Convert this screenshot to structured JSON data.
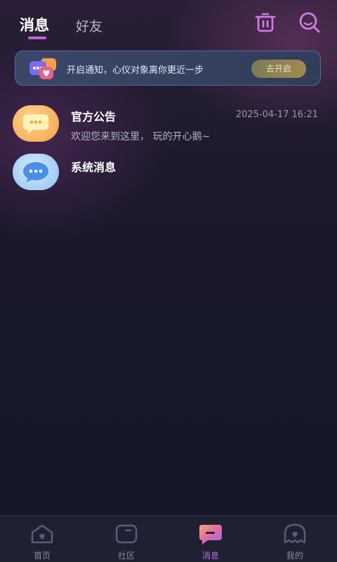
{
  "header": {
    "tabs": [
      {
        "label": "消息",
        "active": true
      },
      {
        "label": "好友",
        "active": false
      }
    ],
    "icons": [
      "trash-icon",
      "search-icon"
    ]
  },
  "banner": {
    "text": "开启通知，心仪对象离你更近一步",
    "button_label": "去开启"
  },
  "messages": [
    {
      "title": "官方公告",
      "time": "2025-04-17 16:21",
      "preview": "欢迎您来到这里， 玩的开心鹅~",
      "icon": "chat-bubble-icon",
      "avatar_color": "#f7b560"
    },
    {
      "title": "系统消息",
      "time": "",
      "preview": "",
      "icon": "chat-bubble-icon",
      "avatar_color": "#8ec3f2"
    }
  ],
  "bottom_nav": [
    {
      "label": "首页",
      "icon": "home-icon",
      "active": false
    },
    {
      "label": "社区",
      "icon": "community-icon",
      "active": false
    },
    {
      "label": "消息",
      "icon": "message-icon",
      "active": true
    },
    {
      "label": "我的",
      "icon": "profile-icon",
      "active": false
    }
  ],
  "colors": {
    "accent": "#c76de8",
    "background": "#161828",
    "banner_button": "#a58a50"
  }
}
